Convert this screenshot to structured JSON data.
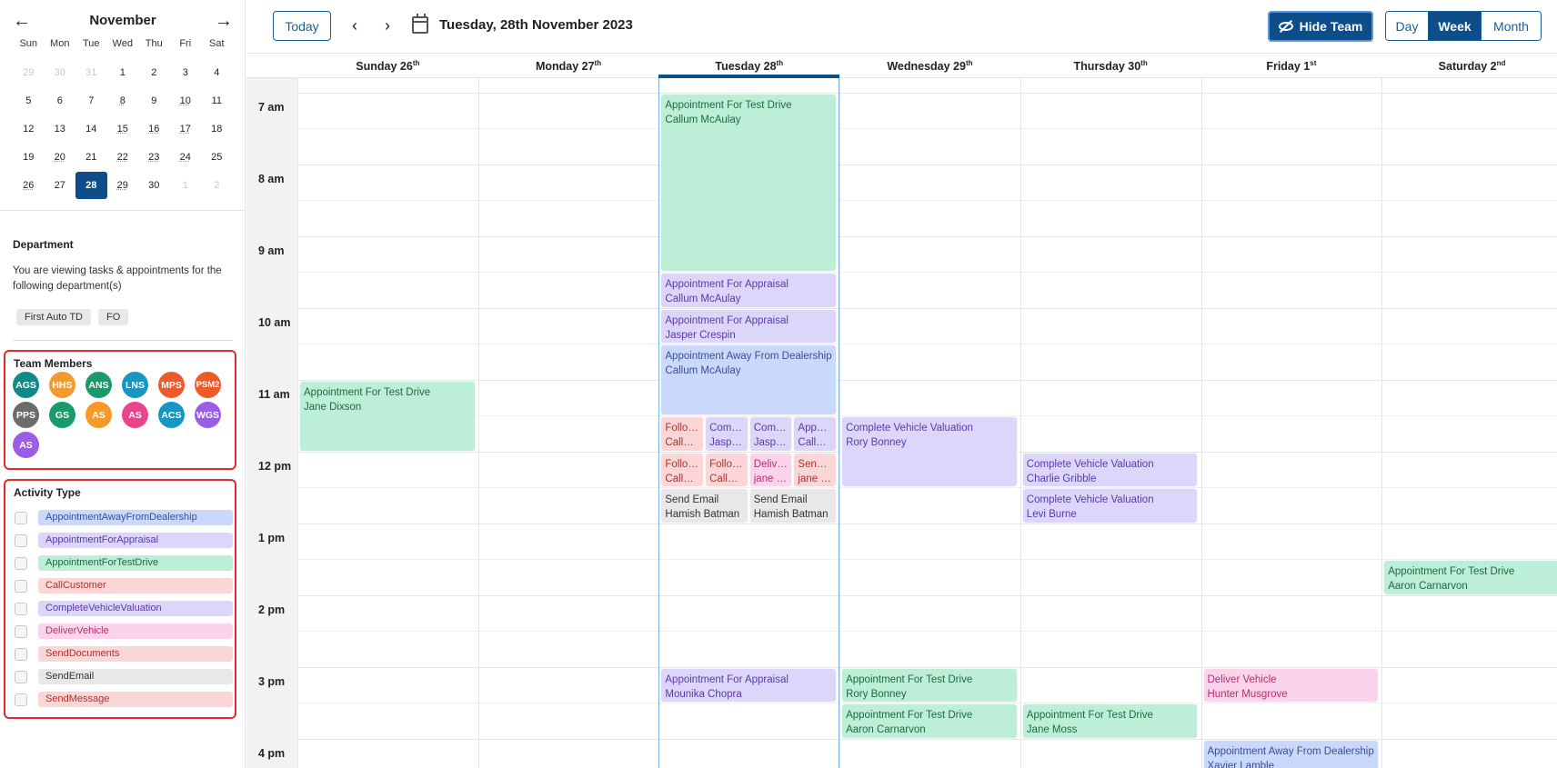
{
  "minical": {
    "month": "November",
    "weekdays": [
      "Sun",
      "Mon",
      "Tue",
      "Wed",
      "Thu",
      "Fri",
      "Sat"
    ],
    "weeks": [
      [
        {
          "d": "29",
          "m": 1
        },
        {
          "d": "30",
          "m": 1
        },
        {
          "d": "31",
          "m": 1
        },
        {
          "d": "1"
        },
        {
          "d": "2"
        },
        {
          "d": "3"
        },
        {
          "d": "4"
        }
      ],
      [
        {
          "d": "5"
        },
        {
          "d": "6"
        },
        {
          "d": "7"
        },
        {
          "d": "8",
          "u": 1
        },
        {
          "d": "9"
        },
        {
          "d": "10",
          "u": 1
        },
        {
          "d": "11"
        }
      ],
      [
        {
          "d": "12"
        },
        {
          "d": "13"
        },
        {
          "d": "14"
        },
        {
          "d": "15",
          "u": 1
        },
        {
          "d": "16",
          "u": 1
        },
        {
          "d": "17",
          "u": 1
        },
        {
          "d": "18"
        }
      ],
      [
        {
          "d": "19"
        },
        {
          "d": "20",
          "u": 1
        },
        {
          "d": "21"
        },
        {
          "d": "22",
          "u": 1
        },
        {
          "d": "23",
          "u": 1
        },
        {
          "d": "24",
          "u": 1
        },
        {
          "d": "25"
        }
      ],
      [
        {
          "d": "26",
          "u": 1
        },
        {
          "d": "27"
        },
        {
          "d": "28",
          "s": 1
        },
        {
          "d": "29",
          "u": 1
        },
        {
          "d": "30"
        },
        {
          "d": "1",
          "m": 1
        },
        {
          "d": "2",
          "m": 1
        }
      ]
    ]
  },
  "department": {
    "title": "Department",
    "text": "You are viewing tasks & appointments for the following department(s)",
    "chips": [
      "First Auto TD",
      "FO"
    ]
  },
  "team": {
    "title": "Team Members",
    "members": [
      {
        "initials": "AGS",
        "color": "#0e8a8a"
      },
      {
        "initials": "HHS",
        "color": "#f39a2b"
      },
      {
        "initials": "ANS",
        "color": "#1b9a6b"
      },
      {
        "initials": "LNS",
        "color": "#1596c4"
      },
      {
        "initials": "MPS",
        "color": "#f05a28"
      },
      {
        "initials": "PSM2",
        "color": "#f05a28"
      },
      {
        "initials": "PPS",
        "color": "#6b6b6b"
      },
      {
        "initials": "GS",
        "color": "#1b9a6b"
      },
      {
        "initials": "AS",
        "color": "#f39a2b"
      },
      {
        "initials": "AS",
        "color": "#e8458a"
      },
      {
        "initials": "ACS",
        "color": "#1596c4"
      },
      {
        "initials": "WGS",
        "color": "#9b5de5"
      },
      {
        "initials": "AS",
        "color": "#9b5de5"
      }
    ]
  },
  "activity": {
    "title": "Activity Type",
    "types": [
      {
        "label": "AppointmentAwayFromDealership",
        "bg": "#cad9fb",
        "fg": "#3a4c9a"
      },
      {
        "label": "AppointmentForAppraisal",
        "bg": "#dcd6fb",
        "fg": "#5a3aa8"
      },
      {
        "label": "AppointmentForTestDrive",
        "bg": "#bdeed7",
        "fg": "#1c6b3e"
      },
      {
        "label": "CallCustomer",
        "bg": "#fbd6d6",
        "fg": "#b0312e"
      },
      {
        "label": "CompleteVehicleValuation",
        "bg": "#dcd6fb",
        "fg": "#5a3aa8"
      },
      {
        "label": "DeliverVehicle",
        "bg": "#fbd3ea",
        "fg": "#b82e6f"
      },
      {
        "label": "SendDocuments",
        "bg": "#fbd6d6",
        "fg": "#b0312e"
      },
      {
        "label": "SendEmail",
        "bg": "#e8e8ea",
        "fg": "#333333"
      },
      {
        "label": "SendMessage",
        "bg": "#fbd6d6",
        "fg": "#b0312e"
      }
    ]
  },
  "toolbar": {
    "today": "Today",
    "prev": "‹",
    "next": "›",
    "date": "Tuesday, 28th November 2023",
    "hide_team": "Hide Team",
    "views": [
      "Day",
      "Week",
      "Month"
    ],
    "active_view": "Week"
  },
  "days": [
    {
      "name": "Sunday 26",
      "sup": "th"
    },
    {
      "name": "Monday 27",
      "sup": "th"
    },
    {
      "name": "Tuesday 28",
      "sup": "th",
      "today": true
    },
    {
      "name": "Wednesday 29",
      "sup": "th"
    },
    {
      "name": "Thursday 30",
      "sup": "th"
    },
    {
      "name": "Friday 1",
      "sup": "st"
    },
    {
      "name": "Saturday 2",
      "sup": "nd"
    }
  ],
  "hours": [
    "7 am",
    "8 am",
    "9 am",
    "10 am",
    "11 am",
    "12 pm",
    "1 pm",
    "2 pm",
    "3 pm",
    "4 pm"
  ],
  "events": [
    {
      "day": 2,
      "start": 7.0,
      "end": 9.5,
      "title": "Appointment For Test Drive",
      "name": "Callum McAulay",
      "type": "green"
    },
    {
      "day": 2,
      "start": 9.5,
      "end": 10.0,
      "title": "Appointment For Appraisal",
      "name": "Callum McAulay",
      "type": "purple"
    },
    {
      "day": 2,
      "start": 10.0,
      "end": 10.5,
      "title": "Appointment For Appraisal",
      "name": "Jasper Crespin",
      "type": "purple"
    },
    {
      "day": 2,
      "start": 10.5,
      "end": 11.5,
      "title": "Appointment Away From Dealership",
      "name": "Callum McAulay",
      "type": "blue"
    },
    {
      "day": 2,
      "start": 11.5,
      "end": 12.0,
      "lane": 0,
      "lanes": 4,
      "title": "Follow Up",
      "name": "Callum McAulay",
      "type": "red"
    },
    {
      "day": 2,
      "start": 11.5,
      "end": 12.0,
      "lane": 1,
      "lanes": 4,
      "title": "Complete Vehicle Valuation",
      "name": "Jasper Crespin",
      "type": "purple"
    },
    {
      "day": 2,
      "start": 11.5,
      "end": 12.0,
      "lane": 2,
      "lanes": 4,
      "title": "Complete Vehicle Valuation",
      "name": "Jasper Crespin",
      "type": "purple"
    },
    {
      "day": 2,
      "start": 11.5,
      "end": 12.0,
      "lane": 3,
      "lanes": 4,
      "title": "Appointment For Appraisal",
      "name": "Callum McAulay",
      "type": "purple"
    },
    {
      "day": 2,
      "start": 12.0,
      "end": 12.5,
      "lane": 0,
      "lanes": 4,
      "title": "Follow Up",
      "name": "Callum McAulay",
      "type": "red"
    },
    {
      "day": 2,
      "start": 12.0,
      "end": 12.5,
      "lane": 1,
      "lanes": 4,
      "title": "Follow Up",
      "name": "Callum McAulay",
      "type": "red"
    },
    {
      "day": 2,
      "start": 12.0,
      "end": 12.5,
      "lane": 2,
      "lanes": 4,
      "title": "Deliver Vehicle",
      "name": "jane dixson",
      "type": "pink"
    },
    {
      "day": 2,
      "start": 12.0,
      "end": 12.5,
      "lane": 3,
      "lanes": 4,
      "title": "Send Message",
      "name": "jane dixson",
      "type": "red"
    },
    {
      "day": 2,
      "start": 12.5,
      "end": 13.0,
      "lane": 0,
      "lanes": 2,
      "title": "Send Email",
      "name": "Hamish Batman",
      "type": "grey"
    },
    {
      "day": 2,
      "start": 12.5,
      "end": 13.0,
      "lane": 1,
      "lanes": 2,
      "title": "Send Email",
      "name": "Hamish Batman",
      "type": "grey"
    },
    {
      "day": 2,
      "start": 15.0,
      "end": 15.5,
      "title": "Appointment For Appraisal",
      "name": "Mounika Chopra",
      "type": "purple"
    },
    {
      "day": 0,
      "start": 11.0,
      "end": 12.0,
      "title": "Appointment For Test Drive",
      "name": "Jane Dixson",
      "type": "green"
    },
    {
      "day": 3,
      "start": 11.5,
      "end": 12.5,
      "title": "Complete Vehicle Valuation",
      "name": "Rory Bonney",
      "type": "purple"
    },
    {
      "day": 3,
      "start": 15.0,
      "end": 15.5,
      "title": "Appointment For Test Drive",
      "name": "Rory Bonney",
      "type": "green"
    },
    {
      "day": 3,
      "start": 15.5,
      "end": 16.0,
      "title": "Appointment For Test Drive",
      "name": "Aaron Carnarvon",
      "type": "green"
    },
    {
      "day": 4,
      "start": 12.0,
      "end": 12.5,
      "title": "Complete Vehicle Valuation",
      "name": "Charlie Gribble",
      "type": "purple"
    },
    {
      "day": 4,
      "start": 12.5,
      "end": 13.0,
      "title": "Complete Vehicle Valuation",
      "name": "Levi Burne",
      "type": "purple"
    },
    {
      "day": 4,
      "start": 15.5,
      "end": 16.0,
      "title": "Appointment For Test Drive",
      "name": "Jane Moss",
      "type": "green"
    },
    {
      "day": 5,
      "start": 15.0,
      "end": 15.5,
      "title": "Deliver Vehicle",
      "name": "Hunter Musgrove",
      "type": "pink"
    },
    {
      "day": 5,
      "start": 16.0,
      "end": 16.6,
      "title": "Appointment Away From Dealership",
      "name": "Xavier Lamble",
      "type": "blue"
    },
    {
      "day": 6,
      "start": 13.5,
      "end": 14.0,
      "title": "Appointment For Test Drive",
      "name": "Aaron Carnarvon",
      "type": "green"
    }
  ]
}
